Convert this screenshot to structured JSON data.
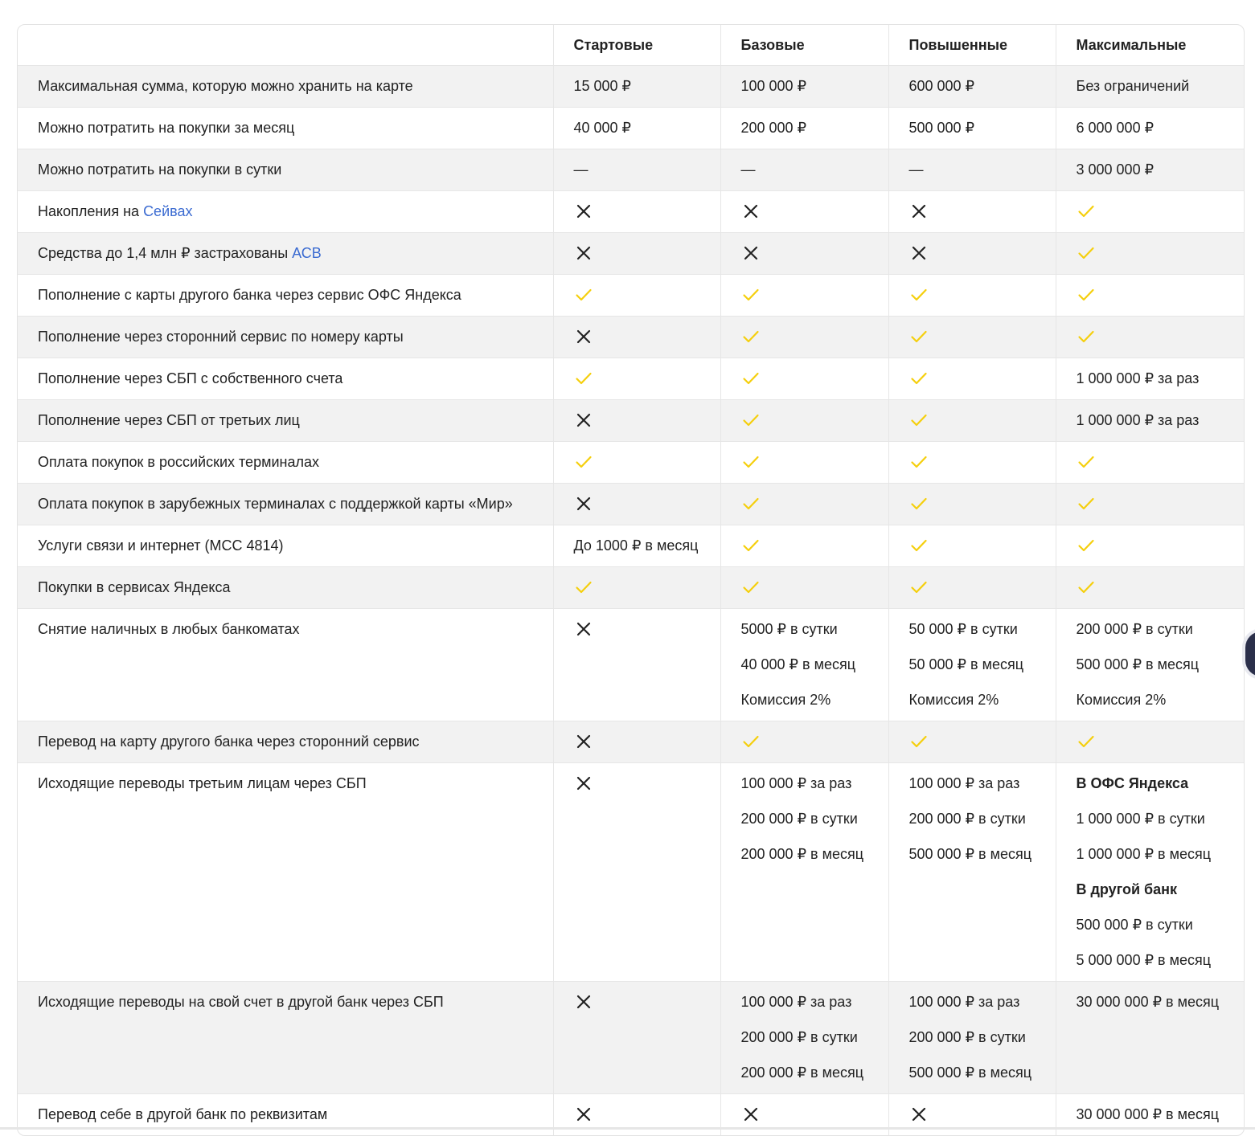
{
  "table": {
    "headers": [
      "",
      "Стартовые",
      "Базовые",
      "Повышенные",
      "Максимальные"
    ],
    "rows": [
      {
        "label": "Максимальная сумма, которую можно хранить на карте",
        "cells": [
          [
            "15 000 ₽"
          ],
          [
            "100 000 ₽"
          ],
          [
            "600 000 ₽"
          ],
          [
            "Без ограничений"
          ]
        ]
      },
      {
        "label": "Можно потратить на покупки за месяц",
        "cells": [
          [
            "40 000 ₽"
          ],
          [
            "200 000 ₽"
          ],
          [
            "500 000 ₽"
          ],
          [
            "6 000 000 ₽"
          ]
        ]
      },
      {
        "label": "Можно потратить на покупки в сутки",
        "cells": [
          [
            "—"
          ],
          [
            "—"
          ],
          [
            "—"
          ],
          [
            "3 000 000 ₽"
          ]
        ]
      },
      {
        "label": "Накопления на ",
        "link": "Сейвах",
        "cells": [
          "no",
          "no",
          "no",
          "yes"
        ]
      },
      {
        "label": "Средства до 1,4 млн ₽ застрахованы ",
        "link": "АСВ",
        "cells": [
          "no",
          "no",
          "no",
          "yes"
        ]
      },
      {
        "label": "Пополнение с карты другого банка через сервис ОФС Яндекса",
        "cells": [
          "yes",
          "yes",
          "yes",
          "yes"
        ]
      },
      {
        "label": "Пополнение через сторонний сервис по номеру карты",
        "cells": [
          "no",
          "yes",
          "yes",
          "yes"
        ]
      },
      {
        "label": "Пополнение через СБП с собственного счета",
        "cells": [
          "yes",
          "yes",
          "yes",
          [
            "1 000 000 ₽ за раз"
          ]
        ]
      },
      {
        "label": "Пополнение через СБП от третьих лиц",
        "cells": [
          "no",
          "yes",
          "yes",
          [
            "1 000 000 ₽ за раз"
          ]
        ]
      },
      {
        "label": "Оплата покупок в российских терминалах",
        "cells": [
          "yes",
          "yes",
          "yes",
          "yes"
        ]
      },
      {
        "label": "Оплата покупок в зарубежных терминалах с поддержкой карты «Мир»",
        "cells": [
          "no",
          "yes",
          "yes",
          "yes"
        ]
      },
      {
        "label": "Услуги связи и интернет (MCC 4814)",
        "cells": [
          [
            "До 1000 ₽ в месяц"
          ],
          "yes",
          "yes",
          "yes"
        ]
      },
      {
        "label": "Покупки в сервисах Яндекса",
        "cells": [
          "yes",
          "yes",
          "yes",
          "yes"
        ]
      },
      {
        "label": "Снятие наличных в любых банкоматах",
        "cells": [
          "no",
          [
            "5000 ₽ в сутки",
            "40 000 ₽ в месяц",
            "Комиссия 2%"
          ],
          [
            "50 000 ₽ в сутки",
            "50 000 ₽ в месяц",
            "Комиссия 2%"
          ],
          [
            "200 000 ₽ в сутки",
            "500 000 ₽ в месяц",
            "Комиссия 2%"
          ]
        ]
      },
      {
        "label": "Перевод на карту другого банка через сторонний сервис",
        "cells": [
          "no",
          "yes",
          "yes",
          "yes"
        ]
      },
      {
        "label": "Исходящие переводы третьим лицам через СБП",
        "cells": [
          "no",
          [
            "100 000 ₽ за раз",
            "200 000 ₽ в сутки",
            "200 000 ₽ в месяц"
          ],
          [
            "100 000 ₽ за раз",
            "200 000 ₽ в сутки",
            "500 000 ₽ в месяц"
          ],
          [
            "**В ОФС Яндекса",
            "1 000 000 ₽ в сутки",
            "1 000 000 ₽ в месяц",
            "**В другой банк",
            "500 000 ₽ в сутки",
            "5 000 000 ₽ в месяц"
          ]
        ]
      },
      {
        "label": "Исходящие переводы на свой счет в другой банк через СБП",
        "cells": [
          "no",
          [
            "100 000 ₽ за раз",
            "200 000 ₽ в сутки",
            "200 000 ₽ в месяц"
          ],
          [
            "100 000 ₽ за раз",
            "200 000 ₽ в сутки",
            "500 000 ₽ в месяц"
          ],
          [
            "30 000 000 ₽ в месяц"
          ]
        ]
      },
      {
        "label": "Перевод себе в другой банк по реквизитам",
        "cells": [
          "no",
          "no",
          "no",
          [
            "30 000 000 ₽ в месяц"
          ]
        ]
      }
    ]
  },
  "icons": {
    "yes": "check-icon",
    "no": "cross-icon"
  },
  "colors": {
    "check": "#f5cf0d",
    "cross": "#222222",
    "link": "#3b6bd1",
    "stripe": "#f2f2f2"
  }
}
